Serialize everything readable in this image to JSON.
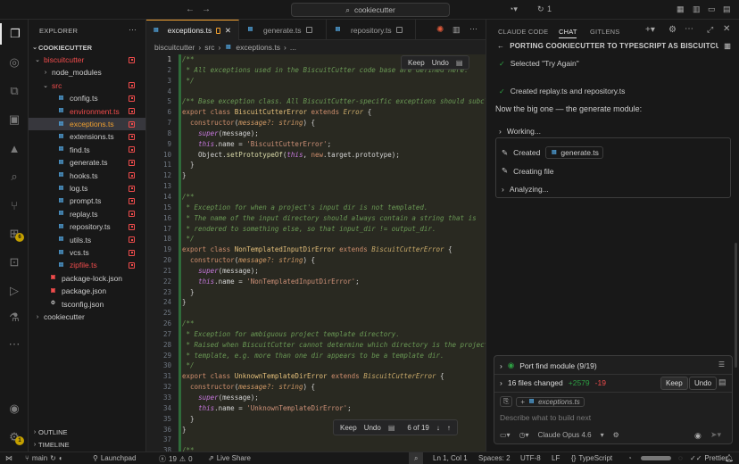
{
  "titlebar": {
    "search_text": "cookiecutter",
    "sync_count": "1"
  },
  "activity": {
    "badge_extensions": "6",
    "badge_account": "1"
  },
  "explorer": {
    "title": "EXPLORER",
    "root": "COOKIECUTTER",
    "items": [
      {
        "label": "biscuitcutter",
        "kind": "folder-open",
        "color": "red",
        "depth": 0,
        "status": true
      },
      {
        "label": "node_modules",
        "kind": "folder",
        "color": "normal",
        "depth": 1,
        "status": false
      },
      {
        "label": "src",
        "kind": "folder-open",
        "color": "red",
        "depth": 1,
        "status": true
      },
      {
        "label": "config.ts",
        "kind": "ts",
        "color": "normal",
        "depth": 2,
        "status": true
      },
      {
        "label": "environment.ts",
        "kind": "ts",
        "color": "red",
        "depth": 2,
        "status": true
      },
      {
        "label": "exceptions.ts",
        "kind": "ts",
        "color": "orange",
        "depth": 2,
        "status": true,
        "selected": true
      },
      {
        "label": "extensions.ts",
        "kind": "ts",
        "color": "normal",
        "depth": 2,
        "status": true
      },
      {
        "label": "find.ts",
        "kind": "ts",
        "color": "normal",
        "depth": 2,
        "status": true
      },
      {
        "label": "generate.ts",
        "kind": "ts",
        "color": "normal",
        "depth": 2,
        "status": true
      },
      {
        "label": "hooks.ts",
        "kind": "ts",
        "color": "normal",
        "depth": 2,
        "status": true
      },
      {
        "label": "log.ts",
        "kind": "ts",
        "color": "normal",
        "depth": 2,
        "status": true
      },
      {
        "label": "prompt.ts",
        "kind": "ts",
        "color": "normal",
        "depth": 2,
        "status": true
      },
      {
        "label": "replay.ts",
        "kind": "ts",
        "color": "normal",
        "depth": 2,
        "status": true
      },
      {
        "label": "repository.ts",
        "kind": "ts",
        "color": "normal",
        "depth": 2,
        "status": true
      },
      {
        "label": "utils.ts",
        "kind": "ts",
        "color": "normal",
        "depth": 2,
        "status": true
      },
      {
        "label": "vcs.ts",
        "kind": "ts",
        "color": "normal",
        "depth": 2,
        "status": true
      },
      {
        "label": "zipfile.ts",
        "kind": "ts",
        "color": "red",
        "depth": 2,
        "status": true
      },
      {
        "label": "package-lock.json",
        "kind": "json-red",
        "color": "normal",
        "depth": 1,
        "status": false
      },
      {
        "label": "package.json",
        "kind": "json-red",
        "color": "normal",
        "depth": 1,
        "status": false
      },
      {
        "label": "tsconfig.json",
        "kind": "gear",
        "color": "normal",
        "depth": 1,
        "status": false
      },
      {
        "label": "cookiecutter",
        "kind": "folder",
        "color": "normal",
        "depth": 0,
        "status": false
      }
    ],
    "outline": "OUTLINE",
    "timeline": "TIMELINE"
  },
  "editor": {
    "tabs": [
      "exceptions.ts",
      "generate.ts",
      "repository.ts"
    ],
    "breadcrumb": [
      "biscuitcutter",
      "src",
      "exceptions.ts",
      "..."
    ],
    "keep_label": "Keep",
    "undo_label": "Undo",
    "change_position": "6 of 19",
    "line_numbers": [
      "1",
      "2",
      "3",
      "4",
      "5",
      "6",
      "7",
      "8",
      "9",
      "10",
      "11",
      "12",
      "13",
      "14",
      "15",
      "16",
      "17",
      "18",
      "19",
      "20",
      "21",
      "22",
      "23",
      "24",
      "25",
      "26",
      "27",
      "28",
      "29",
      "30",
      "31",
      "32",
      "33",
      "34",
      "35",
      "36",
      "37",
      "38"
    ]
  },
  "chat": {
    "tabs": [
      "CLAUDE CODE",
      "CHAT",
      "GITLENS"
    ],
    "conversation_title": "PORTING COOKIECUTTER TO TYPESCRIPT AS BISCUITCUTT...",
    "msg_selected": "Selected \"Try Again\"",
    "msg_created": "Created replay.ts and repository.ts",
    "msg_generate": "Now the big one — the generate module:",
    "working": "Working...",
    "step_created": "Created",
    "step_created_file": "generate.ts",
    "step_creating": "Creating file",
    "step_analyzing": "Analyzing...",
    "todo": "Port find module (9/19)",
    "files_changed": "16 files changed",
    "additions": "+2579",
    "deletions": "-19",
    "keep_label": "Keep",
    "undo_label": "Undo",
    "attachment": "exceptions.ts",
    "input_placeholder": "Describe what to build next",
    "model": "Claude Opus 4.6"
  },
  "statusbar": {
    "branch": "main",
    "launchpad": "Launchpad",
    "errors": "19",
    "warnings": "0",
    "live_share": "Live Share",
    "position": "Ln 1, Col 1",
    "spaces": "Spaces: 2",
    "encoding": "UTF-8",
    "eol": "LF",
    "language": "TypeScript",
    "prettier": "Prettier"
  },
  "colors": {
    "accent": "#f0a030",
    "error": "#f14c4c",
    "added": "#2ea043"
  }
}
